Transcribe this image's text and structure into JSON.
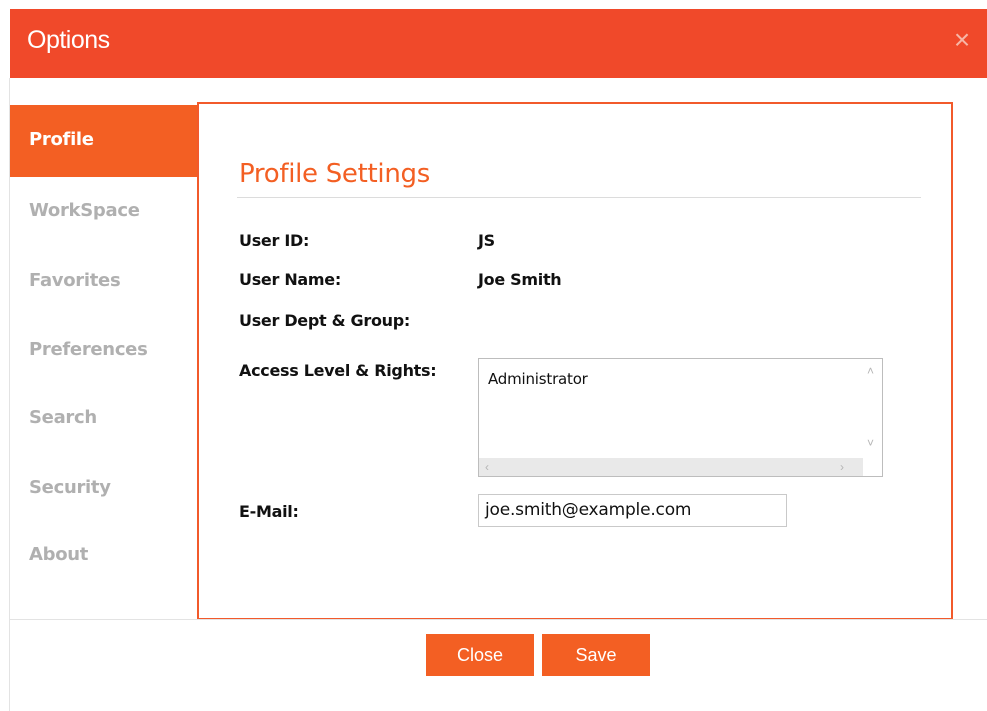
{
  "dialog": {
    "title": "Options",
    "close_icon": "close-icon"
  },
  "sidebar": {
    "items": [
      {
        "label": "Profile",
        "active": true
      },
      {
        "label": "WorkSpace",
        "active": false
      },
      {
        "label": "Favorites",
        "active": false
      },
      {
        "label": "Preferences",
        "active": false
      },
      {
        "label": "Search",
        "active": false
      },
      {
        "label": "Security",
        "active": false
      },
      {
        "label": "About",
        "active": false
      }
    ]
  },
  "profile": {
    "heading": "Profile Settings",
    "user_id_label": "User ID:",
    "user_id_value": "JS",
    "user_name_label": "User Name:",
    "user_name_value": "Joe Smith",
    "dept_label": "User Dept & Group:",
    "access_label": "Access Level & Rights:",
    "access_items": [
      "Administrator"
    ],
    "email_label": "E-Mail:",
    "email_value": "joe.smith@example.com"
  },
  "footer": {
    "close_label": "Close",
    "save_label": "Save"
  },
  "colors": {
    "accent": "#f0492a",
    "active_tab": "#f35f23",
    "inactive_text": "#b0b0b0"
  }
}
